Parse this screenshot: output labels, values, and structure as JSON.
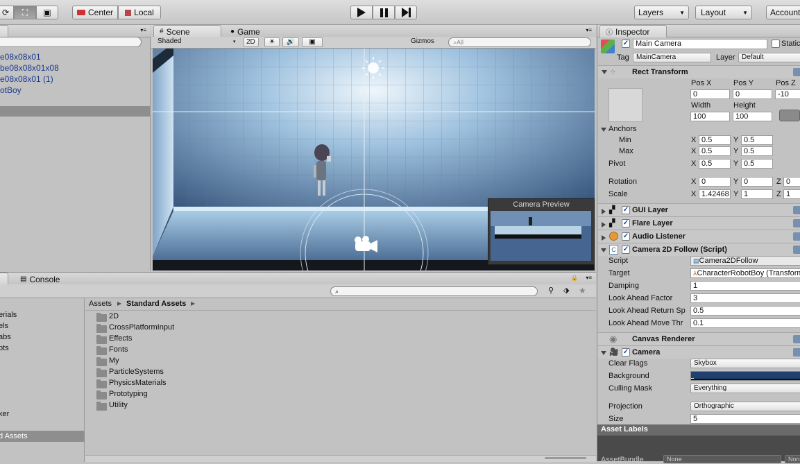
{
  "toolbar": {
    "center_label": "Center",
    "local_label": "Local",
    "layers_label": "Layers",
    "layout_label": "Layout",
    "account_label": "Account"
  },
  "hierarchy": {
    "items": [
      "e08x08x01",
      "be08x08x01x08",
      "e08x08x01 (1)",
      "otBoy"
    ]
  },
  "scene": {
    "tab_scene": "Scene",
    "tab_game": "Game",
    "shading": "Shaded",
    "mode_2d": "2D",
    "gizmos": "Gizmos",
    "search_placeholder": "All",
    "camera_preview_title": "Camera Preview"
  },
  "project": {
    "tab_console": "Console",
    "breadcrumb_root": "Assets",
    "breadcrumb_current": "Standard Assets",
    "sidebar_items": [
      "erials",
      "els",
      "abs",
      "pts",
      "ker",
      "d Assets"
    ],
    "folders": [
      "2D",
      "CrossPlatformInput",
      "Effects",
      "Fonts",
      "My",
      "ParticleSystems",
      "PhysicsMaterials",
      "Prototyping",
      "Utility"
    ]
  },
  "inspector": {
    "tab": "Inspector",
    "object_name": "Main Camera",
    "static_label": "Static",
    "tag_label": "Tag",
    "tag_value": "MainCamera",
    "layer_label": "Layer",
    "layer_value": "Default",
    "rect_transform": {
      "title": "Rect Transform",
      "pos_x_label": "Pos X",
      "pos_y_label": "Pos Y",
      "pos_z_label": "Pos Z",
      "pos_x": "0",
      "pos_y": "0",
      "pos_z": "-10",
      "width_label": "Width",
      "height_label": "Height",
      "width": "100",
      "height": "100",
      "anchors_label": "Anchors",
      "min_label": "Min",
      "max_label": "Max",
      "pivot_label": "Pivot",
      "x": "X",
      "y": "Y",
      "z": "Z",
      "min_x": "0.5",
      "min_y": "0.5",
      "max_x": "0.5",
      "max_y": "0.5",
      "pivot_x": "0.5",
      "pivot_y": "0.5",
      "rotation_label": "Rotation",
      "rot_x": "0",
      "rot_y": "0",
      "rot_z": "0",
      "scale_label": "Scale",
      "scale_x": "1.42468",
      "scale_y": "1",
      "scale_z": "1"
    },
    "components": [
      "GUI Layer",
      "Flare Layer",
      "Audio Listener",
      "Camera 2D Follow (Script)",
      "Canvas Renderer",
      "Camera"
    ],
    "follow": {
      "script_label": "Script",
      "script_value": "Camera2DFollow",
      "target_label": "Target",
      "target_value": "CharacterRobotBoy (Transform)",
      "damping_label": "Damping",
      "damping": "1",
      "look_ahead_factor_label": "Look Ahead Factor",
      "look_ahead_factor": "3",
      "look_ahead_return_label": "Look Ahead Return Sp",
      "look_ahead_return": "0.5",
      "look_ahead_move_label": "Look Ahead Move Thr",
      "look_ahead_move": "0.1"
    },
    "camera": {
      "clear_flags_label": "Clear Flags",
      "clear_flags": "Skybox",
      "background_label": "Background",
      "background_color": "#20406f",
      "culling_mask_label": "Culling Mask",
      "culling_mask": "Everything",
      "projection_label": "Projection",
      "projection": "Orthographic",
      "size_label": "Size",
      "size": "5"
    },
    "asset_labels": "Asset Labels",
    "asset_bundle_label": "AssetBundle",
    "asset_bundle_value": "None"
  }
}
